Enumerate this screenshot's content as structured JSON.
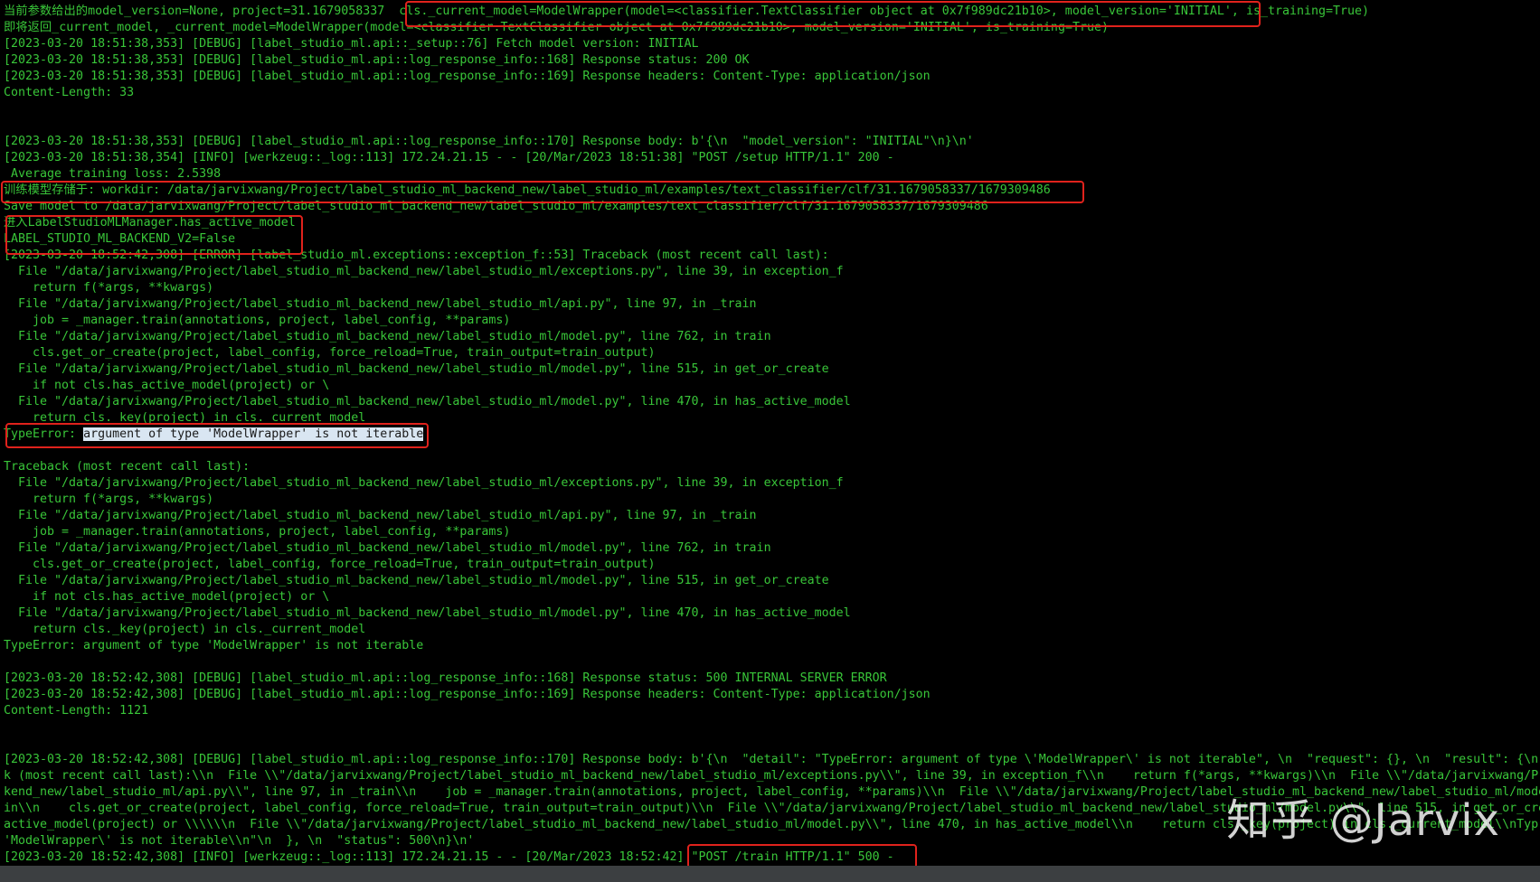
{
  "terminal": {
    "text_color": "#39c639",
    "background": "#000000",
    "annotation_color": "#e0221c",
    "lines": [
      "当前参数给出的model_version=None, project=31.1679058337  cls._current_model=ModelWrapper(model=<classifier.TextClassifier object at 0x7f989dc21b10>, model_version='INITIAL', is_training=True)",
      "即将返回_current_model, _current_model=ModelWrapper(model=<classifier.TextClassifier object at 0x7f989dc21b10>, model_version='INITIAL', is_training=True)",
      "[2023-03-20 18:51:38,353] [DEBUG] [label_studio_ml.api::_setup::76] Fetch model version: INITIAL",
      "[2023-03-20 18:51:38,353] [DEBUG] [label_studio_ml.api::log_response_info::168] Response status: 200 OK",
      "[2023-03-20 18:51:38,353] [DEBUG] [label_studio_ml.api::log_response_info::169] Response headers: Content-Type: application/json",
      "Content-Length: 33",
      "",
      "",
      "[2023-03-20 18:51:38,353] [DEBUG] [label_studio_ml.api::log_response_info::170] Response body: b'{\\n  \"model_version\": \"INITIAL\"\\n}\\n'",
      "[2023-03-20 18:51:38,354] [INFO] [werkzeug::_log::113] 172.24.21.15 - - [20/Mar/2023 18:51:38] \"POST /setup HTTP/1.1\" 200 -",
      " Average training loss: 2.5398",
      "训练模型存储于: workdir: /data/jarvixwang/Project/label_studio_ml_backend_new/label_studio_ml/examples/text_classifier/clf/31.1679058337/1679309486",
      "Save model to /data/jarvixwang/Project/label_studio_ml_backend_new/label_studio_ml/examples/text_classifier/clf/31.1679058337/1679309486",
      "进入LabelStudioMLManager.has_active_model",
      "LABEL_STUDIO_ML_BACKEND_V2=False",
      "[2023-03-20 18:52:42,308] [ERROR] [label_studio_ml.exceptions::exception_f::53] Traceback (most recent call last):",
      "  File \"/data/jarvixwang/Project/label_studio_ml_backend_new/label_studio_ml/exceptions.py\", line 39, in exception_f",
      "    return f(*args, **kwargs)",
      "  File \"/data/jarvixwang/Project/label_studio_ml_backend_new/label_studio_ml/api.py\", line 97, in _train",
      "    job = _manager.train(annotations, project, label_config, **params)",
      "  File \"/data/jarvixwang/Project/label_studio_ml_backend_new/label_studio_ml/model.py\", line 762, in train",
      "    cls.get_or_create(project, label_config, force_reload=True, train_output=train_output)",
      "  File \"/data/jarvixwang/Project/label_studio_ml_backend_new/label_studio_ml/model.py\", line 515, in get_or_create",
      "    if not cls.has_active_model(project) or \\",
      "  File \"/data/jarvixwang/Project/label_studio_ml_backend_new/label_studio_ml/model.py\", line 470, in has_active_model",
      "    return cls._key(project) in cls._current_model",
      "",
      "",
      "Traceback (most recent call last):",
      "  File \"/data/jarvixwang/Project/label_studio_ml_backend_new/label_studio_ml/exceptions.py\", line 39, in exception_f",
      "    return f(*args, **kwargs)",
      "  File \"/data/jarvixwang/Project/label_studio_ml_backend_new/label_studio_ml/api.py\", line 97, in _train",
      "    job = _manager.train(annotations, project, label_config, **params)",
      "  File \"/data/jarvixwang/Project/label_studio_ml_backend_new/label_studio_ml/model.py\", line 762, in train",
      "    cls.get_or_create(project, label_config, force_reload=True, train_output=train_output)",
      "  File \"/data/jarvixwang/Project/label_studio_ml_backend_new/label_studio_ml/model.py\", line 515, in get_or_create",
      "    if not cls.has_active_model(project) or \\",
      "  File \"/data/jarvixwang/Project/label_studio_ml_backend_new/label_studio_ml/model.py\", line 470, in has_active_model",
      "    return cls._key(project) in cls._current_model",
      "TypeError: argument of type 'ModelWrapper' is not iterable",
      "",
      "[2023-03-20 18:52:42,308] [DEBUG] [label_studio_ml.api::log_response_info::168] Response status: 500 INTERNAL SERVER ERROR",
      "[2023-03-20 18:52:42,308] [DEBUG] [label_studio_ml.api::log_response_info::169] Response headers: Content-Type: application/json",
      "Content-Length: 1121",
      "",
      "",
      "[2023-03-20 18:52:42,308] [DEBUG] [label_studio_ml.api::log_response_info::170] Response body: b'{\\n  \"detail\": \"TypeError: argument of type \\'ModelWrapper\\' is not iterable\", \\n  \"request\": {}, \\n  \"result\": {\\n",
      "k (most recent call last):\\\\n  File \\\\\"/data/jarvixwang/Project/label_studio_ml_backend_new/label_studio_ml/exceptions.py\\\\\", line 39, in exception_f\\\\n    return f(*args, **kwargs)\\\\n  File \\\\\"/data/jarvixwang/Pr",
      "kend_new/label_studio_ml/api.py\\\\\", line 97, in _train\\\\n    job = _manager.train(annotations, project, label_config, **params)\\\\n  File \\\\\"/data/jarvixwang/Project/label_studio_ml_backend_new/label_studio_ml/mode",
      "in\\\\n    cls.get_or_create(project, label_config, force_reload=True, train_output=train_output)\\\\n  File \\\\\"/data/jarvixwang/Project/label_studio_ml_backend_new/label_studio_ml/model.py\\\\\", line 515, in get_or_cre",
      "active_model(project) or \\\\\\\\\\\\n  File \\\\\"/data/jarvixwang/Project/label_studio_ml_backend_new/label_studio_ml/model.py\\\\\", line 470, in has_active_model\\\\n    return cls._key(project) in cls._current_model\\\\nTyp",
      "'ModelWrapper\\' is not iterable\\\\n\"\\n  }, \\n  \"status\": 500\\n}\\n'",
      "[2023-03-20 18:52:42,308] [INFO] [werkzeug::_log::113] 172.24.21.15 - - [20/Mar/2023 18:52:42] \"POST /train HTTP/1.1\" 500 -"
    ],
    "error_line": {
      "prefix": "TypeError: ",
      "highlighted": "argument of type 'ModelWrapper' is not iterable"
    }
  },
  "watermark": "知乎 @Jarvix"
}
